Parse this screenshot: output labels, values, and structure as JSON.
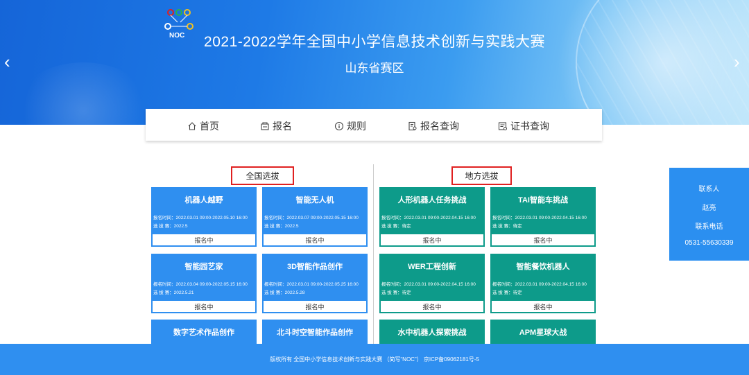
{
  "banner": {
    "title": "2021-2022学年全国中小学信息技术创新与实践大赛",
    "subtitle": "山东省赛区",
    "logo_text": "NOC",
    "prev_arrow": "‹",
    "next_arrow": "›"
  },
  "nav": {
    "items": [
      {
        "label": "首页",
        "icon": "home-icon"
      },
      {
        "label": "报名",
        "icon": "register-icon"
      },
      {
        "label": "规则",
        "icon": "info-icon"
      },
      {
        "label": "报名查询",
        "icon": "search-doc-icon"
      },
      {
        "label": "证书查询",
        "icon": "certificate-icon"
      }
    ]
  },
  "sections": {
    "national": "全国选拔",
    "local": "地方选拔"
  },
  "cards": [
    {
      "title": "机器人越野",
      "time": "报名时间：2022.03.01 09:00-2022.05.10 16:00",
      "select": "选 拔 赛：2022.5",
      "status": "报名中",
      "color": "blue"
    },
    {
      "title": "智能无人机",
      "time": "报名时间：2022.03.07 09:00-2022.05.15 16:00",
      "select": "选 拔 赛：2022.5",
      "status": "报名中",
      "color": "blue"
    },
    {
      "title": "人形机器人任务挑战",
      "time": "报名时间：2022.03.01 09:00-2022.04.15 16:00",
      "select": "选 拔 赛：待定",
      "status": "报名中",
      "color": "green"
    },
    {
      "title": "TAI智能车挑战",
      "time": "报名时间：2022.03.01 09:00-2022.04.15 16:00",
      "select": "选 拔 赛：待定",
      "status": "报名中",
      "color": "green"
    },
    {
      "title": "智能园艺家",
      "time": "报名时间：2022.03.04 09:00-2022.05.15 16:00",
      "select": "选 拔 赛：2022.5.21",
      "status": "报名中",
      "color": "blue"
    },
    {
      "title": "3D智能作品创作",
      "time": "报名时间：2022.03.01 09:00-2022.05.25 16:00",
      "select": "选 拔 赛：2022.5.28",
      "status": "报名中",
      "color": "blue"
    },
    {
      "title": "WER工程创新",
      "time": "报名时间：2022.03.01 09:00-2022.04.15 16:00",
      "select": "选 拔 赛：待定",
      "status": "报名中",
      "color": "green"
    },
    {
      "title": "智能餐饮机器人",
      "time": "报名时间：2022.03.01 09:00-2022.04.15 16:00",
      "select": "选 拔 赛：待定",
      "status": "报名中",
      "color": "green"
    },
    {
      "title": "数字艺术作品创作",
      "time": "",
      "select": "",
      "status": "",
      "color": "blue"
    },
    {
      "title": "北斗时空智能作品创作",
      "time": "",
      "select": "",
      "status": "",
      "color": "blue"
    },
    {
      "title": "水中机器人探索挑战",
      "time": "",
      "select": "",
      "status": "",
      "color": "green"
    },
    {
      "title": "APM星球大战",
      "time": "",
      "select": "",
      "status": "",
      "color": "green"
    }
  ],
  "contact": {
    "person_label": "联系人",
    "person": "赵亮",
    "phone_label": "联系电话",
    "phone": "0531-55630339"
  },
  "footer": {
    "text": "版权所有 全国中小学信息技术创新与实践大赛 （简写“NOC”） 京ICP备09062181号-5"
  },
  "colors": {
    "primary_blue": "#2f8ff0",
    "local_green": "#0d9b8a",
    "highlight_red": "#e02020"
  }
}
